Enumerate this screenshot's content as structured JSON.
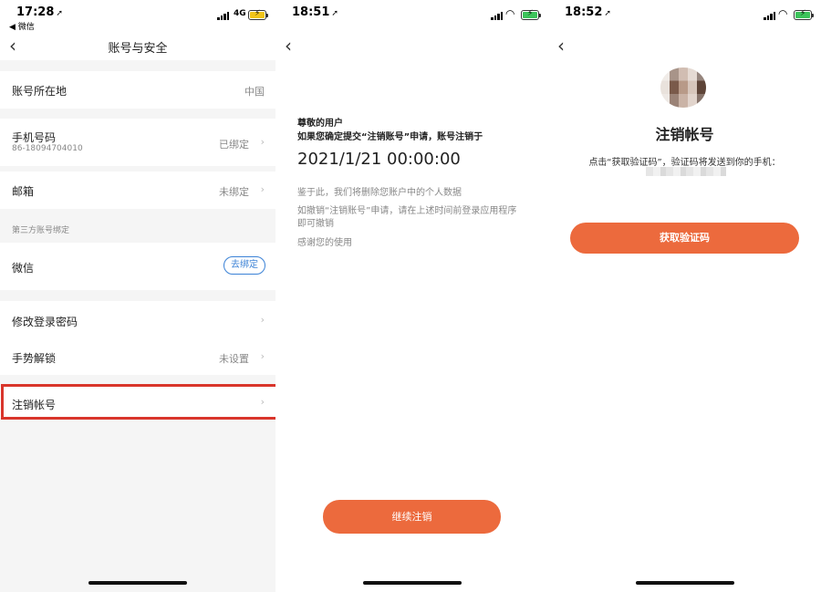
{
  "screen1": {
    "status": {
      "time": "17:28",
      "back_app": "◀ 微信",
      "network": "4G"
    },
    "title": "账号与安全",
    "rows": {
      "location": {
        "label": "账号所在地",
        "value": "中国"
      },
      "phone": {
        "label": "手机号码",
        "sub": "86-18094704010",
        "value": "已绑定"
      },
      "email": {
        "label": "邮箱",
        "value": "未绑定"
      },
      "third_party_section": "第三方账号绑定",
      "wechat": {
        "label": "微信",
        "action": "去绑定"
      },
      "password": {
        "label": "修改登录密码"
      },
      "gesture": {
        "label": "手势解锁",
        "value": "未设置"
      },
      "deregister": {
        "label": "注销帐号"
      }
    },
    "highlight_color": "#d9352b"
  },
  "screen2": {
    "status": {
      "time": "18:51"
    },
    "greeting": "尊敬的用户",
    "confirm_text": "如果您确定提交“注销账号”申请，账号注销于",
    "datetime": "2021/1/21 00:00:00",
    "notice1": "鉴于此，我们将删除您账户中的个人数据",
    "notice2_line1": "如撤销“注销账号”申请，请在上述时间前登录应用程序",
    "notice2_line2": "即可撤销",
    "thanks": "感谢您的使用",
    "button": "继续注销"
  },
  "screen3": {
    "status": {
      "time": "18:52"
    },
    "title": "注销帐号",
    "description": "点击“获取验证码”，验证码将发送到你的手机：",
    "button": "获取验证码"
  },
  "colors": {
    "accent": "#ec6a3d",
    "link_blue": "#3b82d6"
  }
}
